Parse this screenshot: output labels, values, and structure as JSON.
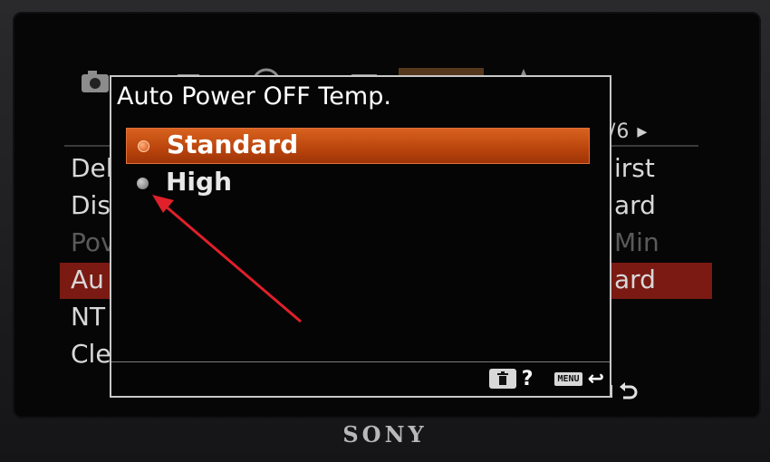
{
  "dialog": {
    "title": "Auto Power OFF Temp.",
    "options": [
      {
        "label": "Standard",
        "selected": true
      },
      {
        "label": "High",
        "selected": false
      }
    ]
  },
  "background_menu": {
    "page_indicator": "/6 ▸",
    "rows": [
      {
        "left": "Del",
        "right": "irst",
        "dim": false,
        "highlight": false
      },
      {
        "left": "Dis",
        "right": "ard",
        "dim": false,
        "highlight": false
      },
      {
        "left": "Pov",
        "right": "Min",
        "dim": true,
        "highlight": false
      },
      {
        "left": "Au",
        "right": "ard",
        "dim": false,
        "highlight": true
      },
      {
        "left": "NT",
        "right": "",
        "dim": false,
        "highlight": false
      },
      {
        "left": "Cle",
        "right": "",
        "dim": false,
        "highlight": false
      }
    ]
  },
  "footer": {
    "help_label": "?",
    "menu_label": "MENU",
    "back_glyph": "↩"
  },
  "brand": "SONY",
  "colors": {
    "selection": "#c9501a",
    "arrow": "#e0202a",
    "highlight_row": "#7a1a12"
  }
}
